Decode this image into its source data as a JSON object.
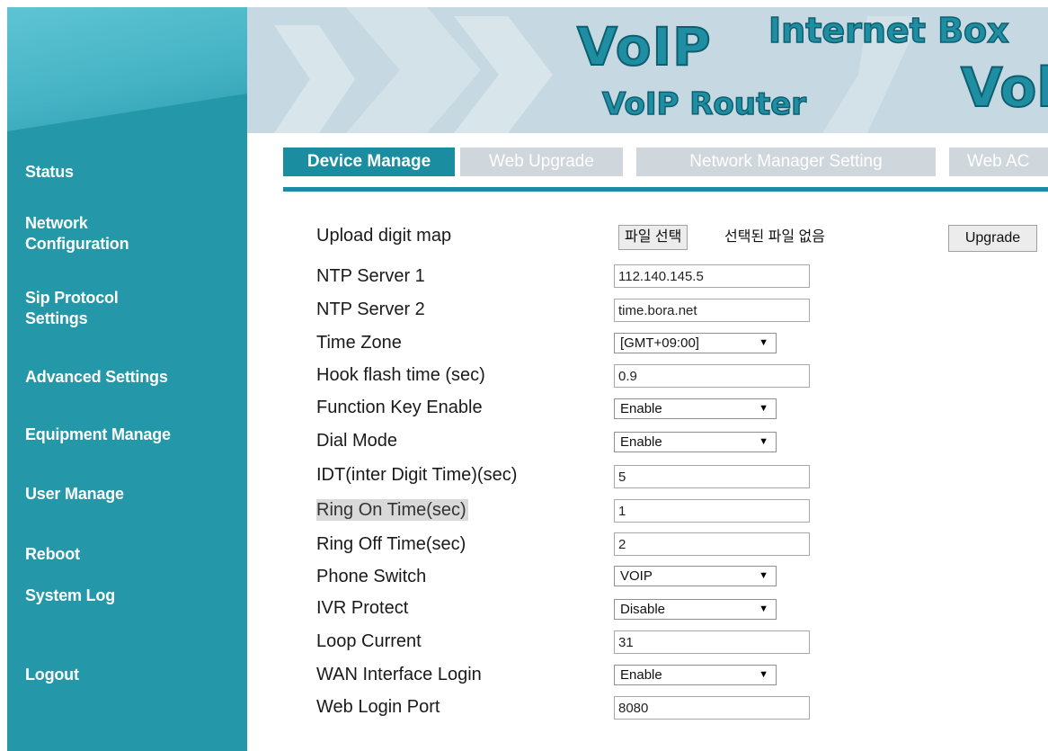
{
  "banner": {
    "title_voip": "VoIP",
    "title_internet_box": "Internet Box",
    "title_voip_router": "VoIP Router",
    "title_cutoff": "Vol"
  },
  "sidebar": {
    "items": [
      {
        "label": "Status"
      },
      {
        "label": "Network Configuration"
      },
      {
        "label": "Sip Protocol Settings"
      },
      {
        "label": "Advanced Settings"
      },
      {
        "label": "Equipment Manage"
      },
      {
        "label": "User Manage"
      },
      {
        "label": "Reboot"
      },
      {
        "label": "System Log"
      },
      {
        "label": "Logout"
      }
    ]
  },
  "tabs": [
    {
      "label": "Device Manage",
      "active": true
    },
    {
      "label": "Web Upgrade"
    },
    {
      "label": "Network Manager Setting"
    },
    {
      "label": "Web AC"
    }
  ],
  "upload": {
    "label": "Upload digit map",
    "file_button": "파일 선택",
    "file_status": "선택된 파일 없음",
    "upgrade_button": "Upgrade"
  },
  "form": {
    "ntp1": {
      "label": "NTP Server 1",
      "value": "112.140.145.5"
    },
    "ntp2": {
      "label": "NTP Server 2",
      "value": "time.bora.net"
    },
    "timezone": {
      "label": "Time Zone",
      "value": "[GMT+09:00]"
    },
    "hook_flash": {
      "label": "Hook flash time (sec)",
      "value": "0.9"
    },
    "function_key": {
      "label": "Function Key Enable",
      "value": "Enable"
    },
    "dial_mode": {
      "label": "Dial Mode",
      "value": "Enable"
    },
    "idt": {
      "label": "IDT(inter Digit Time)(sec)",
      "value": "5"
    },
    "ring_on": {
      "label": "Ring On Time(sec)",
      "value": "1"
    },
    "ring_off": {
      "label": "Ring Off Time(sec)",
      "value": "2"
    },
    "phone_switch": {
      "label": "Phone Switch",
      "value": "VOIP"
    },
    "ivr_protect": {
      "label": "IVR Protect",
      "value": "Disable"
    },
    "loop_current": {
      "label": "Loop Current",
      "value": "31"
    },
    "wan_login": {
      "label": "WAN Interface Login",
      "value": "Enable"
    },
    "web_port": {
      "label": "Web Login Port",
      "value": "8080"
    }
  },
  "colors": {
    "sidebar_bg": "#2497a8",
    "accent": "#1a8ea0",
    "tab_inactive": "#cfd7dc",
    "banner_bg": "#c6d8e1"
  },
  "icons": {
    "select_arrow": "triangle-down-icon"
  }
}
